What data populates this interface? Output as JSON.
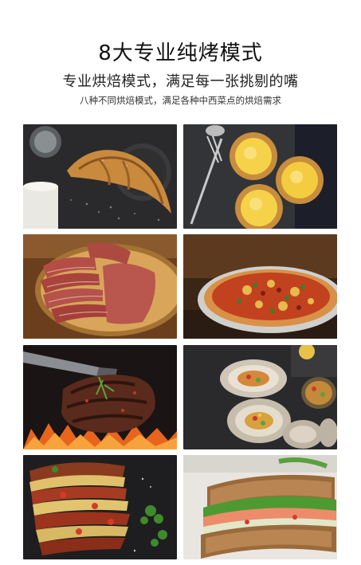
{
  "header": {
    "title": "8大专业纯烤模式",
    "subtitle": "专业烘焙模式，满足每一张挑剔的嘴",
    "caption": "八种不同烘焙模式，满足各种中西菜点的烘焙需求"
  },
  "tiles": [
    {
      "icon": "croissant-image"
    },
    {
      "icon": "egg-tart-image"
    },
    {
      "icon": "sliced-meat-image"
    },
    {
      "icon": "pizza-image"
    },
    {
      "icon": "grilled-steak-image"
    },
    {
      "icon": "baked-oysters-image"
    },
    {
      "icon": "layered-dish-image"
    },
    {
      "icon": "sandwich-image"
    }
  ],
  "colors": {
    "background": "#ffffff",
    "title": "#111111"
  }
}
